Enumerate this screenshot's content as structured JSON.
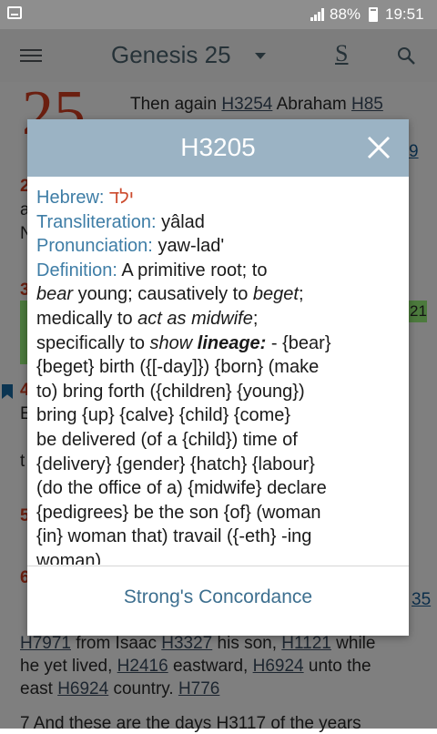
{
  "status_bar": {
    "battery": "88%",
    "time": "19:51"
  },
  "app_bar": {
    "title": "Genesis 25",
    "strongs_toggle": "S"
  },
  "background_text": {
    "chapter_number": "25",
    "v1": {
      "text1": "Then again ",
      "link1": "H3254",
      "text2": " Abraham ",
      "link2": "H85"
    },
    "v6_lines": [
      {
        "link": "H7971",
        "text": " from Isaac ",
        "link2": "H3327",
        "text2": " his son, ",
        "link3": "H1121",
        "text3": " while"
      },
      {
        "text": "he yet lived, ",
        "link": "H2416",
        "text2": " eastward, ",
        "link2": "H6924",
        "text3": " unto the"
      },
      {
        "text": "east ",
        "link": "H6924",
        "text2": " country. ",
        "link2": "H776"
      }
    ],
    "v7": "7 And these are the days H3117 of the years",
    "fragments": {
      "f1": "9",
      "f2": "2",
      "f3": "a",
      "f4": "N",
      "f5": "3",
      "f6": "4",
      "f7": "E",
      "f8": "t",
      "f9": "5",
      "f10": "6",
      "f11": "35",
      "f12": "21"
    }
  },
  "dialog": {
    "title": "H3205",
    "hebrew_label": "Hebrew:",
    "hebrew_value": "ילד",
    "translit_label": "Transliteration:",
    "translit_value": "yâlad",
    "pron_label": "Pronunciation:",
    "pron_value": "yaw-lad'",
    "def_label": "Definition:",
    "def_lines": [
      " A primitive root; to",
      "bear young; causatively to beget;",
      "medically to act as midwife;",
      "specifically to show lineage: - {bear}",
      "{beget} birth ({[-day]}) {born} (make",
      "to) bring forth ({children} {young})",
      "bring {up} {calve} {child} {come}",
      "be delivered (of a {child}) time of",
      "{delivery} {gender} {hatch} {labour}",
      "(do the office of a) {midwife} declare",
      "{pedigrees} be the son {of} (woman",
      "{in} woman that) travail ({-eth} -ing",
      "woman)"
    ],
    "footer_button": "Strong's Concordance"
  },
  "colors": {
    "header": "#9bb3c4",
    "label": "#3e7da6",
    "hebrew": "#cc4b2e",
    "scrim": "#7f7f7f"
  }
}
